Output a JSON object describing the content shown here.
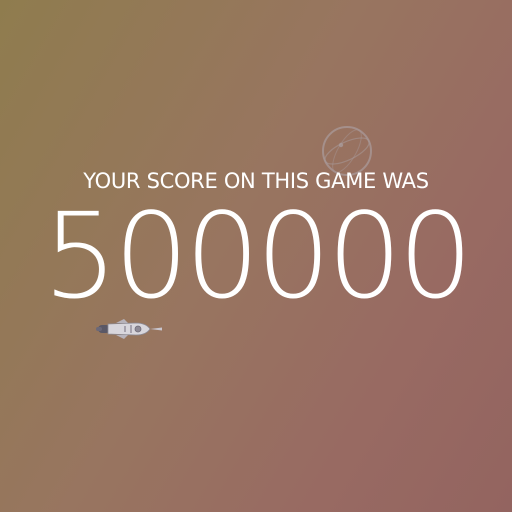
{
  "game": {
    "score_caption": "YOUR SCORE ON THIS GAME WAS",
    "score_value": "500000"
  },
  "icons": {
    "planet": "planet-icon",
    "ship": "spaceship-icon"
  },
  "colors": {
    "background_start": "#8f7c4e",
    "background_end": "#936460",
    "text": "#ffffff"
  }
}
